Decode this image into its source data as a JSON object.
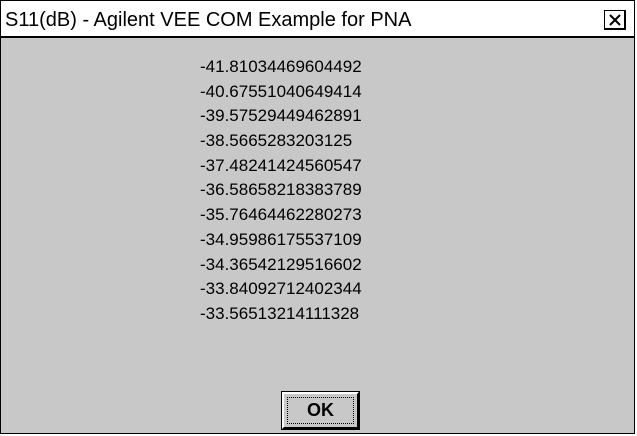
{
  "window": {
    "title": "S11(dB) - Agilent VEE COM Example for PNA",
    "close_icon": "close-x-icon"
  },
  "values": [
    "-41.81034469604492",
    "-40.67551040649414",
    "-39.57529449462891",
    "-38.5665283203125",
    "-37.48241424560547",
    "-36.58658218383789",
    "-35.76464462280273",
    "-34.95986175537109",
    "-34.36542129516602",
    "-33.84092712402344",
    "-33.56513214111328"
  ],
  "buttons": {
    "ok_label": "OK"
  },
  "colors": {
    "background": "#c8c8c8",
    "titlebar": "#ffffff",
    "text": "#000000"
  }
}
